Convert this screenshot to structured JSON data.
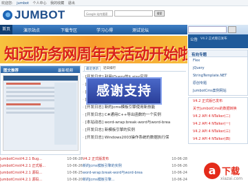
{
  "topbar": {
    "welcome": "欢迎您:",
    "user": "jumbot",
    "links": [
      "个人中心",
      "我的收藏",
      "退出"
    ]
  },
  "logo": {
    "text": "JUMBOT"
  },
  "search": {
    "google_label": "Google 站内搜索",
    "button": "搜索"
  },
  "nav": {
    "items": [
      "首页",
      "演示站点",
      "下载专区",
      "学习心得",
      "测试论坛"
    ],
    "active_index": 0
  },
  "banner": {
    "text": "知远防务网周年庆活动开始啦!"
  },
  "photo_news": {
    "title": "图文推荐",
    "more": "最新视频"
  },
  "news": {
    "tabs": [
      "最近更新",
      "近日排行"
    ],
    "active_tab": 0,
    "items": [
      "[开发日志] 利用jQuery的$.ajax实现...",
      "[开发日志] 网站首页信息的动态更新",
      "[开发日志] 程序中采用Js实现...",
      "[开发日志] Top.in的消息窗口",
      "[开发日志] 新的jcms模板引擎使用新技能",
      "[开发日志] C#通用C++导出函数的一个实例",
      "[本站动态] word-wrap:break-word与word-brea",
      "[开发日志] 新模板引擎的实例",
      "[开发日志] Windows2003操作系统的数据执行保"
    ]
  },
  "thanks_badge": {
    "text": "感谢支持"
  },
  "sidebar": {
    "gonggao_title": "公告",
    "gonggao_text": "V4.2 正式版已发布",
    "box1": {
      "title": "有向专题",
      "items": [
        "Flex",
        "jQuery",
        "StringTemplate.NET",
        "原创专题",
        "JumbotCms案例网站"
      ]
    },
    "box2": {
      "title": "",
      "items": [
        "V4.2 正式版已发布",
        "关于JumbotCms的数据转换",
        "V4.2 API 4 NTalker(二)",
        "V4.2 API 4 NTalker(一)",
        "V4.2 API 4 NTalker(三)",
        "V4.2 API 4 NTalker(四)"
      ]
    }
  },
  "bottom_left": [
    {
      "title": "JumbotCmsV4.2.1 Bug...",
      "date": "10-06-28"
    },
    {
      "title": "JumbotCmsV4.2.1 正式版...",
      "date": "10-06-26"
    },
    {
      "title": "JumbotCmsV4.2.1 源码...",
      "date": "10-06-25"
    },
    {
      "title": "JumbotCmsV4.2.1 源码...",
      "date": "10-06-20"
    }
  ],
  "bottom_right": [
    {
      "title": "V4.2 正式版发布",
      "date": "10-06-28"
    },
    {
      "title": "新的jcms模板引擎的实例",
      "date": "10-06-26"
    },
    {
      "title": "word-wrap:break-word与word-brea",
      "date": "10-06-24"
    },
    {
      "title": "新的Jcms模板引擎...",
      "date": "10-06-24"
    }
  ],
  "watermark": {
    "char": "a",
    "brand": "下载",
    "url": "xiazai.com"
  },
  "colors": {
    "nav_blue": "#1f5a9a",
    "banner_orange": "#f79c2e",
    "banner_text": "#d9221c",
    "accent_red": "#e42b1a"
  }
}
